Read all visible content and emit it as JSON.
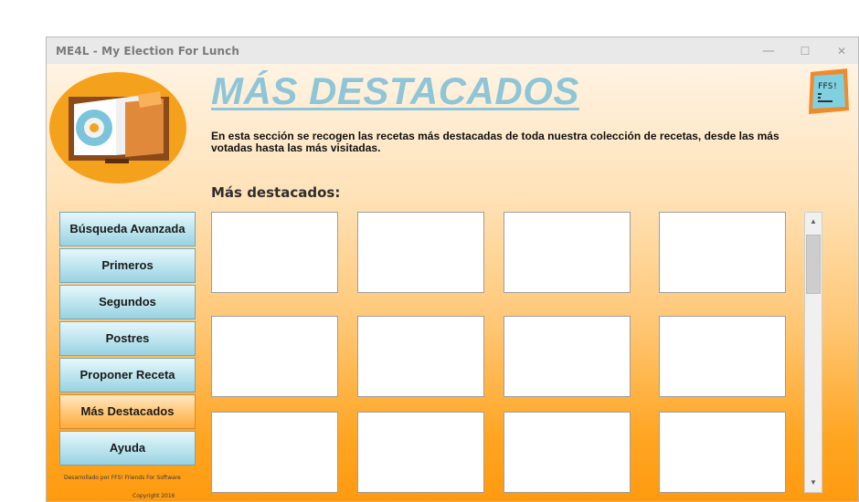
{
  "window": {
    "title": "ME4L - My Election For Lunch",
    "minimize": "—",
    "maximize": "☐",
    "close": "✕"
  },
  "header": {
    "title": "MÁS DESTACADOS",
    "description": "En esta sección se recogen las recetas más destacadas de toda nuestra colección de recetas, desde las más votadas hasta las más visitadas.",
    "section_heading": "Más destacados:",
    "ffs_logo_text": "FFS!"
  },
  "sidebar": {
    "items": [
      {
        "label": "Búsqueda Avanzada"
      },
      {
        "label": "Primeros"
      },
      {
        "label": "Segundos"
      },
      {
        "label": "Postres"
      },
      {
        "label": "Proponer Receta"
      },
      {
        "label": "Más Destacados",
        "active": true
      },
      {
        "label": "Ayuda"
      }
    ],
    "credit_line1": "Desarrollado por FFS! Friends For Software",
    "credit_line2": "Copyright 2016"
  },
  "scrollbar": {
    "up_arrow": "▲",
    "down_arrow": "▼"
  },
  "colors": {
    "title": "#8ec6d8",
    "nav_button": "#bfe6ef",
    "nav_active": "#ffc87a",
    "background_top": "#fff3e3",
    "background_bottom": "#ff9a0e"
  }
}
